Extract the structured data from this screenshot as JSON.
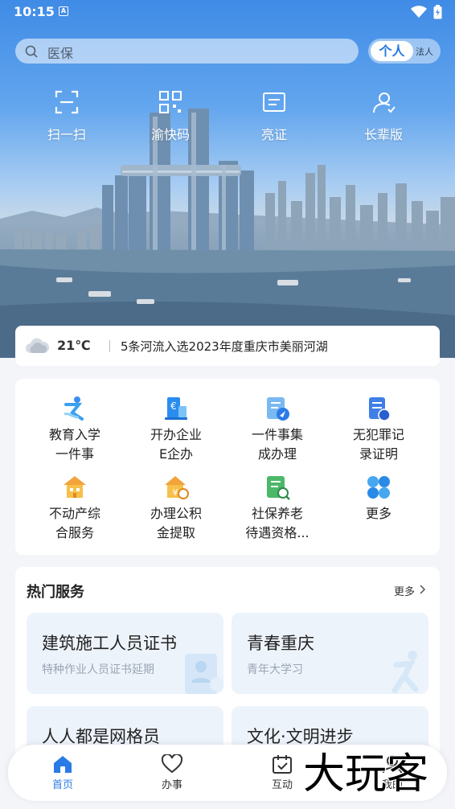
{
  "status": {
    "time": "10:15",
    "badge": "A"
  },
  "search": {
    "placeholder": "医保"
  },
  "identity_toggle": {
    "active": "个人",
    "inactive": "法人"
  },
  "quick_actions": [
    {
      "icon": "scan-icon",
      "label": "扫一扫"
    },
    {
      "icon": "qr-code-icon",
      "label": "渝快码"
    },
    {
      "icon": "id-card-icon",
      "label": "亮证"
    },
    {
      "icon": "elderly-mode-icon",
      "label": "长辈版"
    }
  ],
  "news_bar": {
    "temperature": "21℃",
    "weather_icon": "cloudy-icon",
    "headline": "5条河流入选2023年度重庆市美丽河湖"
  },
  "services": [
    {
      "icon": "education-icon",
      "label": "教育入学\n一件事"
    },
    {
      "icon": "enterprise-icon",
      "label": "开办企业\nE企办"
    },
    {
      "icon": "bundle-icon",
      "label": "一件事集\n成办理"
    },
    {
      "icon": "certificate-icon",
      "label": "无犯罪记\n录证明"
    },
    {
      "icon": "property-icon",
      "label": "不动产综\n合服务"
    },
    {
      "icon": "housing-fund-icon",
      "label": "办理公积\n金提取"
    },
    {
      "icon": "social-security-icon",
      "label": "社保养老\n待遇资格..."
    },
    {
      "icon": "more-grid-icon",
      "label": "更多"
    }
  ],
  "hot_services": {
    "title": "热门服务",
    "more": "更多",
    "items": [
      {
        "title": "建筑施工人员证书",
        "subtitle": "特种作业人员证书延期"
      },
      {
        "title": "青春重庆",
        "subtitle": "青年大学习"
      },
      {
        "title": "人人都是网格员",
        "subtitle": ""
      },
      {
        "title": "文化·文明进步",
        "subtitle": ""
      }
    ]
  },
  "bottom_nav": [
    {
      "icon": "home-icon",
      "label": "首页",
      "active": true
    },
    {
      "icon": "heart-icon",
      "label": "办事",
      "active": false
    },
    {
      "icon": "calendar-check-icon",
      "label": "互动",
      "active": false
    },
    {
      "icon": "user-icon",
      "label": "我的",
      "active": false
    }
  ],
  "watermark": "大玩客",
  "colors": {
    "accent": "#2a7be5",
    "tile_bg": "#edf3fb"
  }
}
